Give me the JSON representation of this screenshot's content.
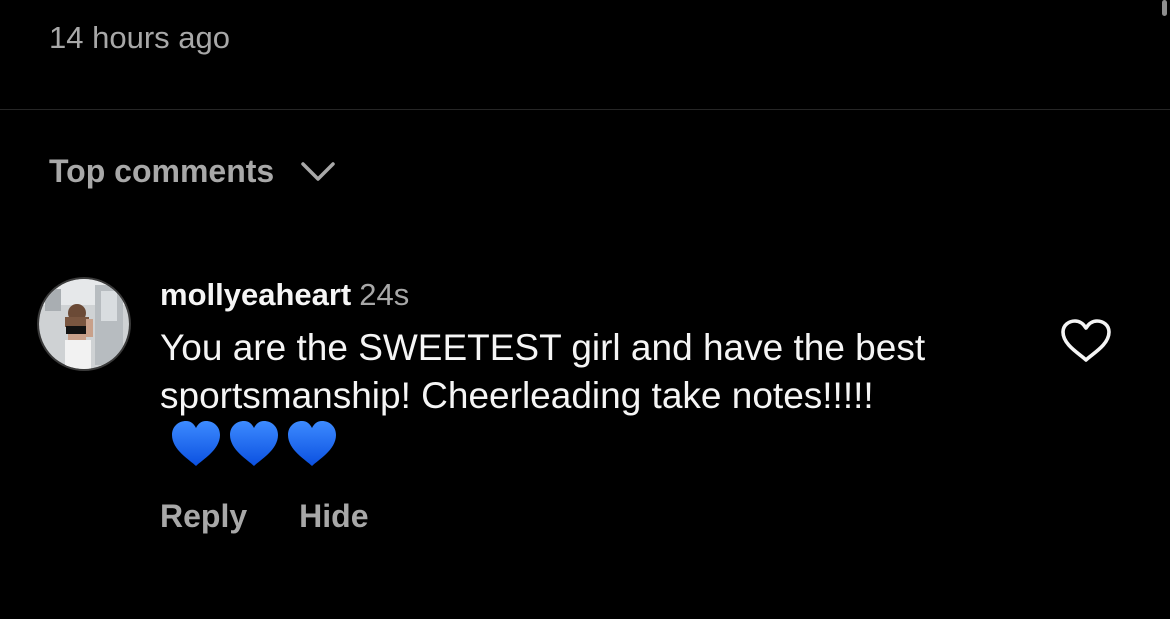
{
  "post": {
    "timestamp": "14 hours ago"
  },
  "comments_section": {
    "sort_label": "Top comments",
    "sort_icon": "chevron-down-icon"
  },
  "comment": {
    "username": "mollyeaheart",
    "age": "24s",
    "text": "You are the SWEETEST girl and have the best sportsmanship! Cheerleading take notes!!!!!",
    "emoji": [
      "💙",
      "💙",
      "💙"
    ],
    "reply_label": "Reply",
    "hide_label": "Hide",
    "like_icon": "heart-outline-icon",
    "avatar_icon": "avatar"
  },
  "colors": {
    "background": "#000000",
    "primary_text": "#f5f5f5",
    "secondary_text": "#a8a8a8",
    "divider": "#262626",
    "emoji_heart": "#1f6fff"
  }
}
